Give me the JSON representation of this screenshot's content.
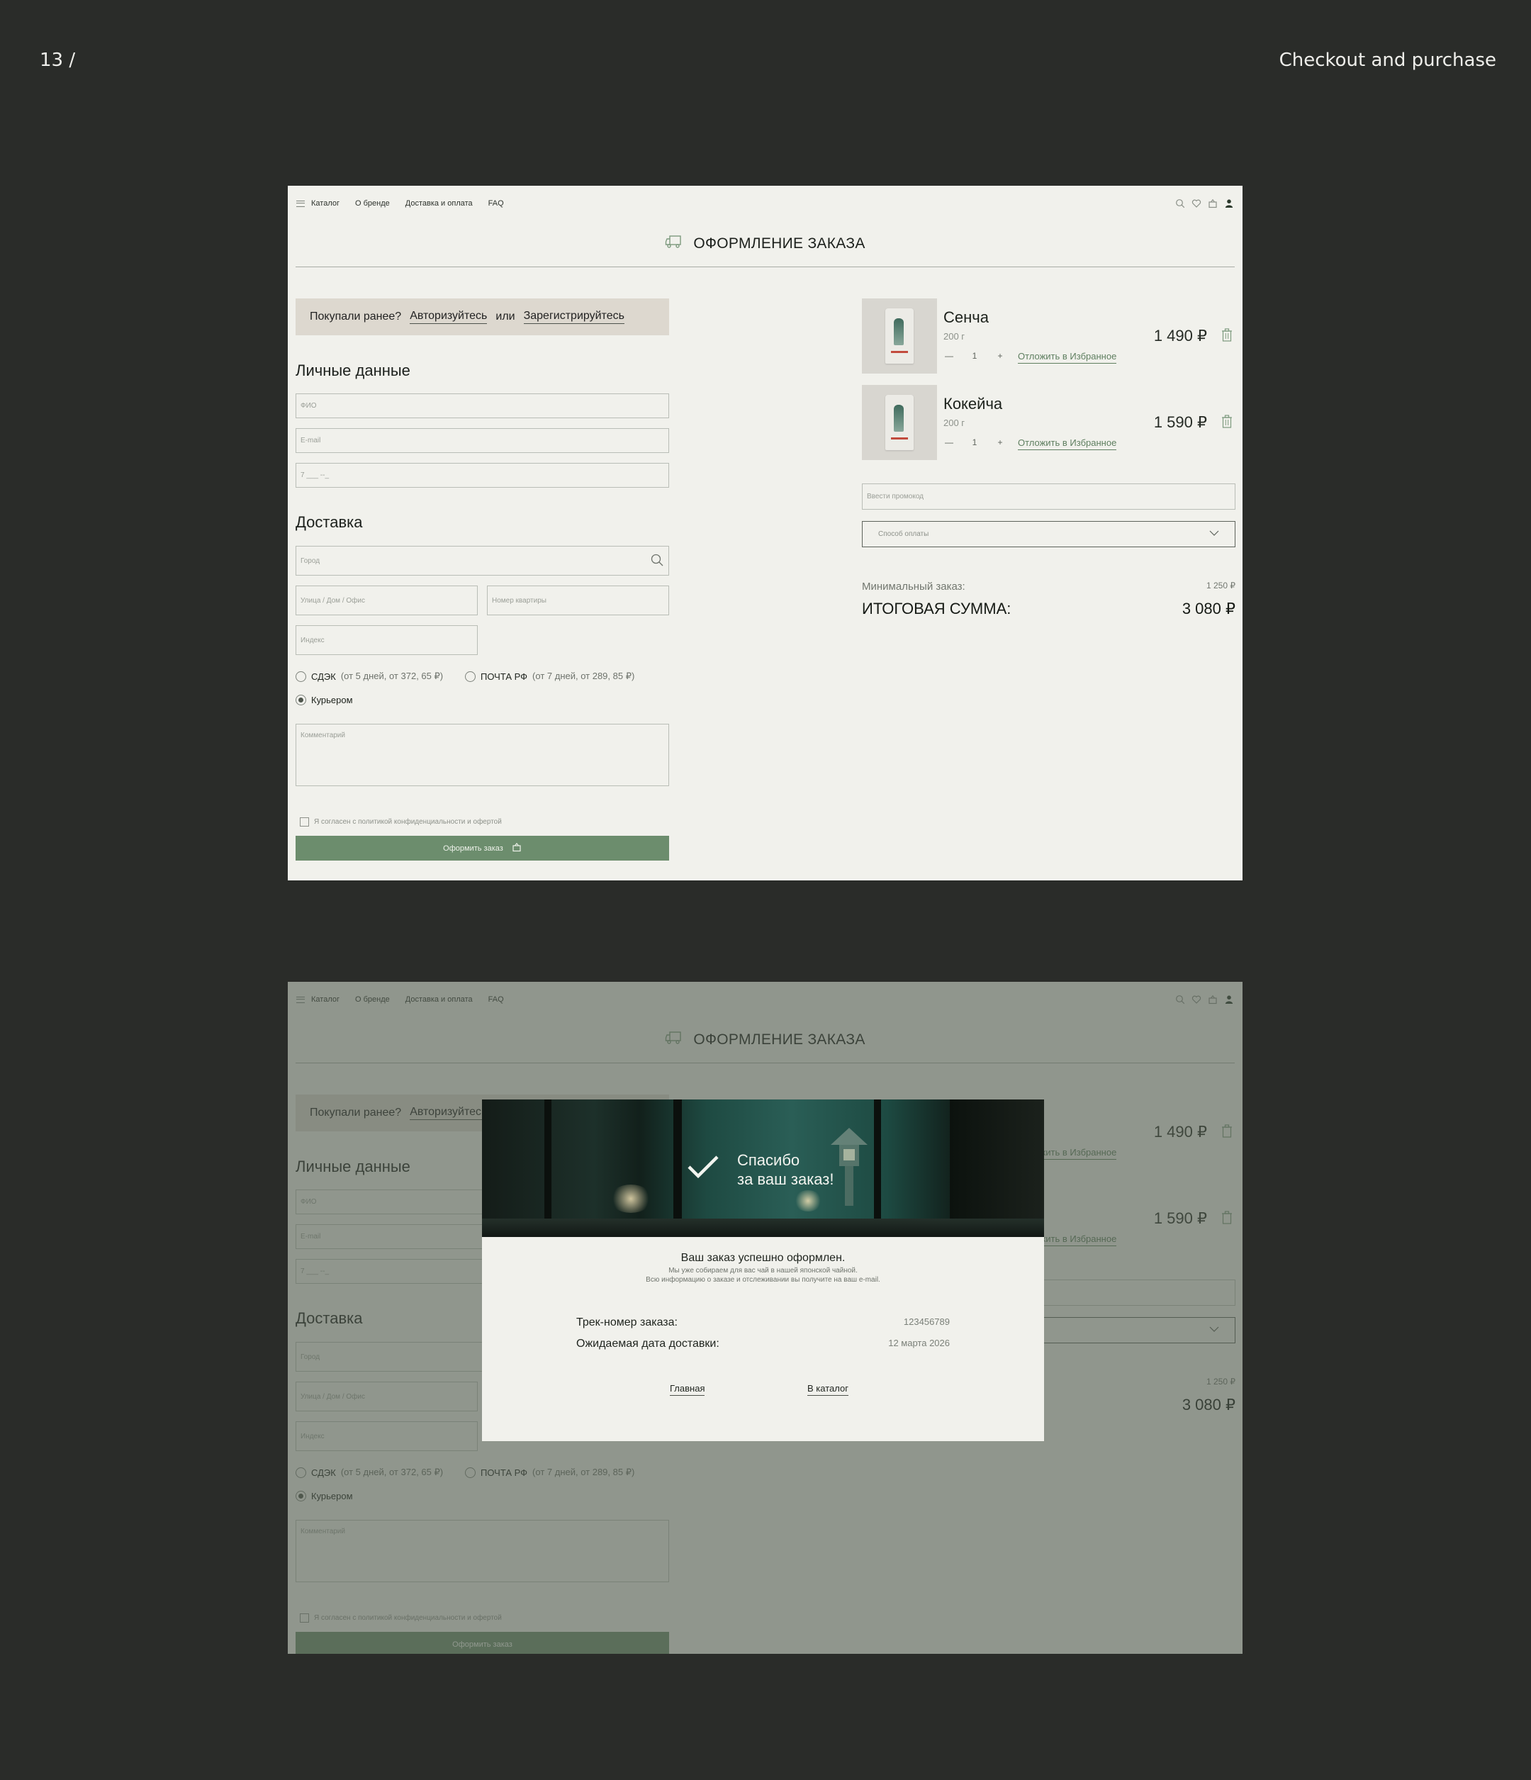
{
  "slide": {
    "number": "13 /",
    "section": "Checkout and purchase"
  },
  "colors": {
    "background": "#2a2c29",
    "page": "#f1f1ec",
    "accent_green": "#6c8d6d",
    "banner": "#ddd8cf"
  },
  "nav": {
    "links": [
      "Каталог",
      "О бренде",
      "Доставка и оплата",
      "FAQ"
    ],
    "icons": [
      "search-icon",
      "heart-icon",
      "basket-icon",
      "user-icon"
    ]
  },
  "page_title": "ОФОРМЛЕНИЕ ЗАКАЗА",
  "login_banner": {
    "question": "Покупали ранее?",
    "login": "Авторизуйтесь",
    "or": "или",
    "register": "Зарегистрируйтесь"
  },
  "personal": {
    "heading": "Личные данные",
    "fio_placeholder": "ФИО",
    "email_placeholder": "E-mail",
    "phone_placeholder": "7 ___ --_"
  },
  "delivery": {
    "heading": "Доставка",
    "city_placeholder": "Город",
    "street_placeholder": "Улица / Дом / Офис",
    "apartment_placeholder": "Номер квартиры",
    "index_placeholder": "Индекс",
    "options": [
      {
        "name": "СДЭК",
        "note": "(от 5 дней, от 372, 65 ₽)",
        "selected": false
      },
      {
        "name": "ПОЧТА РФ",
        "note": "(от 7 дней, от 289, 85 ₽)",
        "selected": false
      },
      {
        "name": "Курьером",
        "note": "",
        "selected": true
      }
    ],
    "comment_placeholder": "Комментарий"
  },
  "agreement": "Я согласен с политикой конфиденциальности и офертой",
  "submit_label": "Оформить заказ",
  "cart": {
    "items": [
      {
        "name": "Сенча",
        "weight": "200 г",
        "qty": "1",
        "favorite": "Отложить в Избранное",
        "price": "1 490 ₽"
      },
      {
        "name": "Кокейча",
        "weight": "200 г",
        "qty": "1",
        "favorite": "Отложить в Избранное",
        "price": "1 590 ₽"
      }
    ],
    "promo_placeholder": "Ввести промокод",
    "payment_placeholder": "Способ оплаты",
    "min_order_label": "Минимальный заказ:",
    "min_order_value": "1 250 ₽",
    "total_label": "ИТОГОВАЯ СУММА:",
    "total_value": "3 080 ₽"
  },
  "modal": {
    "thanks_line1": "Спасибо",
    "thanks_line2": "за ваш заказ!",
    "success": "Ваш заказ успешно оформлен.",
    "sub_line1": "Мы уже собираем для вас чай в нашей японской чайной.",
    "sub_line2": "Всю информацию о заказе и отслеживании вы получите на ваш e-mail.",
    "track_label": "Трек-номер заказа:",
    "track_value": "123456789",
    "date_label": "Ожидаемая дата доставки:",
    "date_value": "12 марта 2026",
    "home_link": "Главная",
    "catalog_link": "В каталог"
  }
}
